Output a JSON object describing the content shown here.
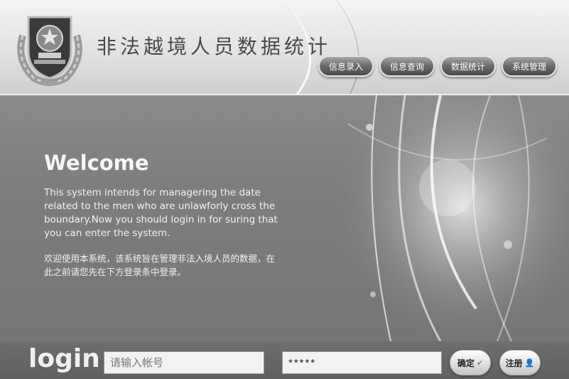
{
  "header": {
    "title": "非法越境人员数据统计",
    "nav": [
      {
        "label": "信息录入"
      },
      {
        "label": "信息查询"
      },
      {
        "label": "数据统计"
      },
      {
        "label": "系统管理"
      }
    ]
  },
  "welcome": {
    "title": "Welcome",
    "text_en": "This system intends for managering the date related to the men who are unlawforly cross the boundary.Now you should login in for suring that you can enter the system.",
    "text_cn": "欢迎使用本系统，该系统旨在管理非法入境人员的数据，在此之前请您先在下方登录条中登录。"
  },
  "login": {
    "label": "login",
    "username_placeholder": "请输入帐号",
    "password_value": "*****",
    "confirm_label": "确定",
    "register_label": "注册"
  }
}
